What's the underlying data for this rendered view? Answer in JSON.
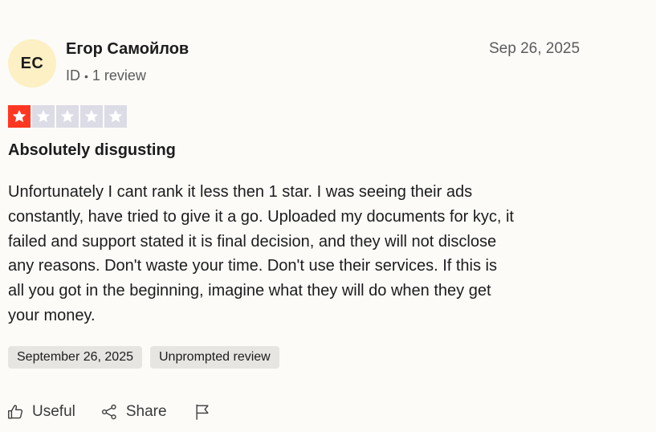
{
  "author": {
    "initials": "ЕС",
    "name": "Егор Самойлов",
    "country": "ID",
    "separator": "•",
    "review_count": "1 review"
  },
  "review": {
    "date": "Sep 26, 2025",
    "rating": 1,
    "rating_max": 5,
    "title": "Absolutely disgusting",
    "body": "Unfortunately I cant rank it less then 1 star. I was seeing their ads\nconstantly, have tried to give it a go. Uploaded my documents for kyc, it\nfailed and support stated it is final decision, and they will not disclose\nany reasons. Don't waste your time. Don't use their services. If this is\nall you got in the beginning, imagine what they will do when they get\nyour money.",
    "tags": [
      "September 26, 2025",
      "Unprompted review"
    ]
  },
  "actions": {
    "useful_label": "Useful",
    "useful_icon": "thumbs-up-icon",
    "share_label": "Share",
    "share_icon": "share-icon",
    "flag_icon": "flag-icon"
  },
  "colors": {
    "star_filled": "#ff3722",
    "star_empty": "#dcdce6",
    "avatar_bg": "#fcf0c4",
    "tag_bg": "#e6e5e2"
  }
}
